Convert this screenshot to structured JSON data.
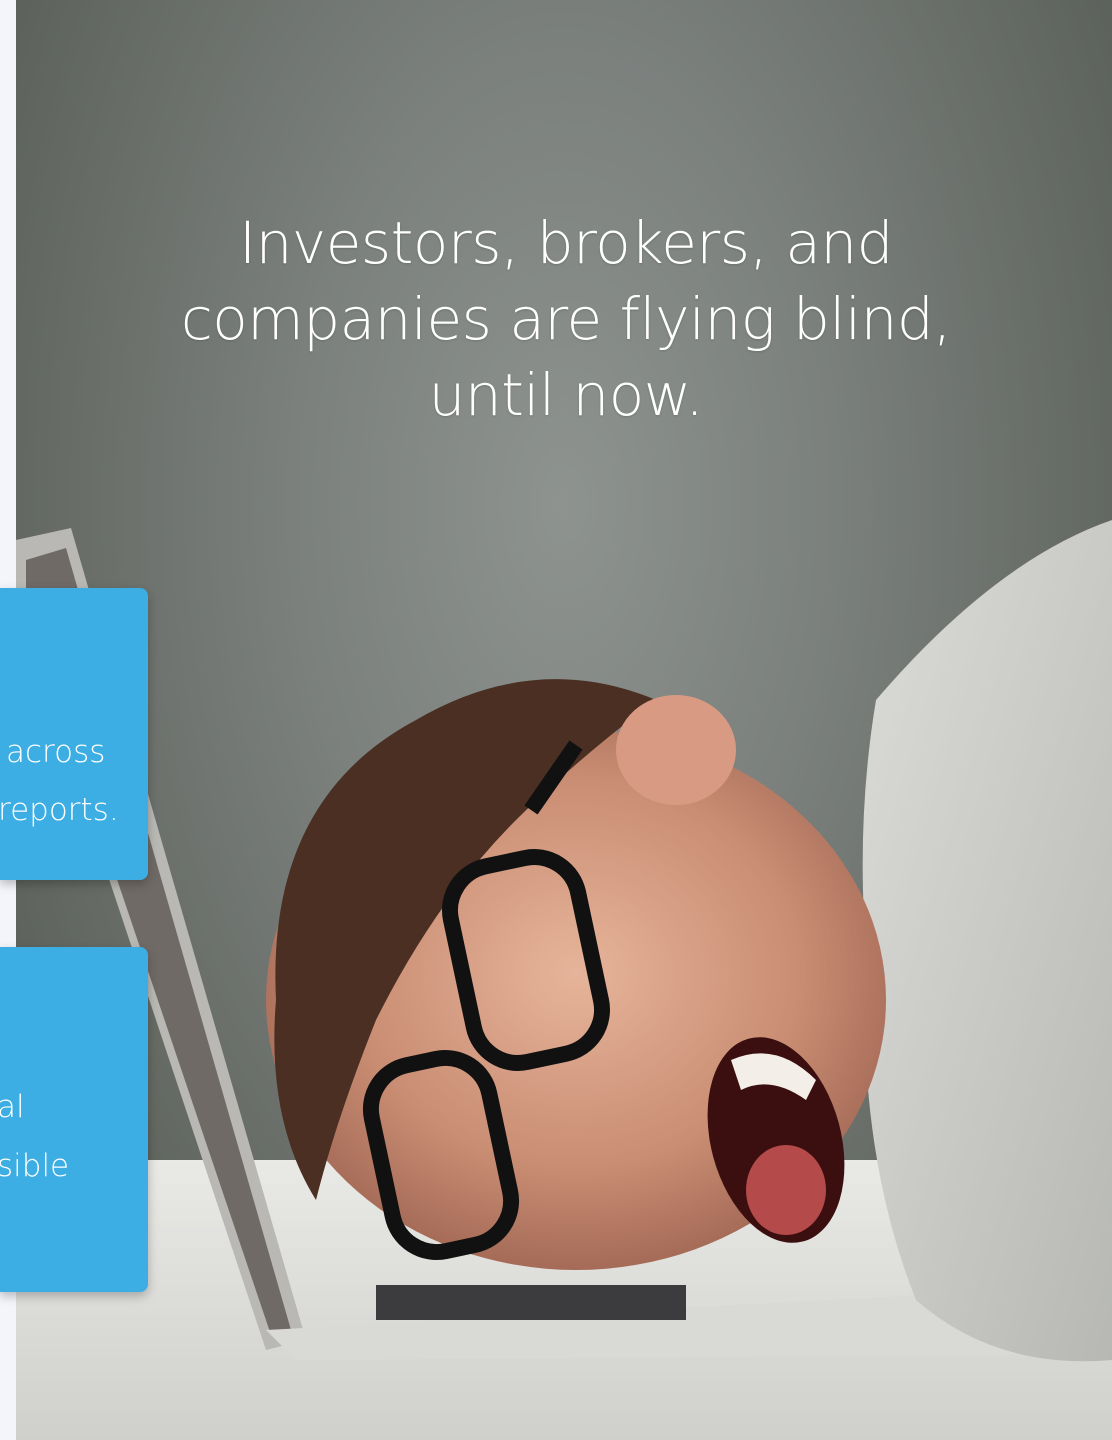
{
  "hero": {
    "headline_lines": [
      "Investors, brokers, and",
      "companies are flying blind,",
      "until now."
    ]
  },
  "cards": [
    {
      "lines": [
        "across",
        "reports."
      ]
    },
    {
      "lines": [
        "al",
        "sible"
      ]
    }
  ],
  "colors": {
    "card_blue": "#3daee3",
    "headline_text": "#ffffff",
    "background_gray": "#7b807d"
  }
}
